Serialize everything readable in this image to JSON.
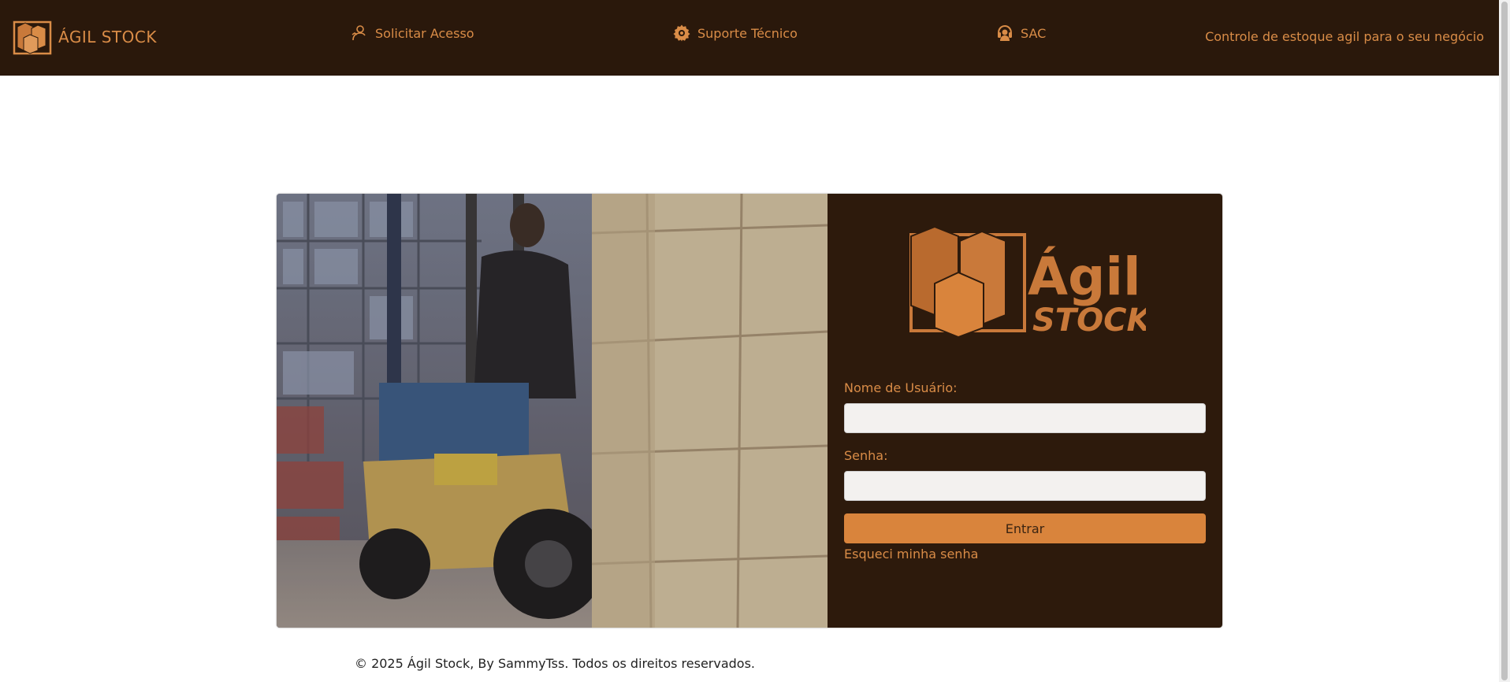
{
  "nav": {
    "brand": "ÁGIL STOCK",
    "links": [
      {
        "label": "Solicitar Acesso",
        "icon": "user-request-icon"
      },
      {
        "label": "Suporte Técnico",
        "icon": "gear-icon"
      },
      {
        "label": "SAC",
        "icon": "headset-icon"
      }
    ],
    "tagline": "Controle de estoque agil para o seu negócio"
  },
  "login": {
    "logo_text_top": "Ágil",
    "logo_text_bottom": "STOCK",
    "username_label": "Nome de Usuário:",
    "username_value": "",
    "password_label": "Senha:",
    "password_value": "",
    "submit_label": "Entrar",
    "forgot_label": "Esqueci minha senha"
  },
  "footer": {
    "text": "© 2025 Ágil Stock, By SammyTss. Todos os direitos reservados."
  },
  "colors": {
    "nav_bg": "#2a180b",
    "accent": "#d98c47",
    "form_bg": "#2d1a0c",
    "button_bg": "#d9843c"
  }
}
